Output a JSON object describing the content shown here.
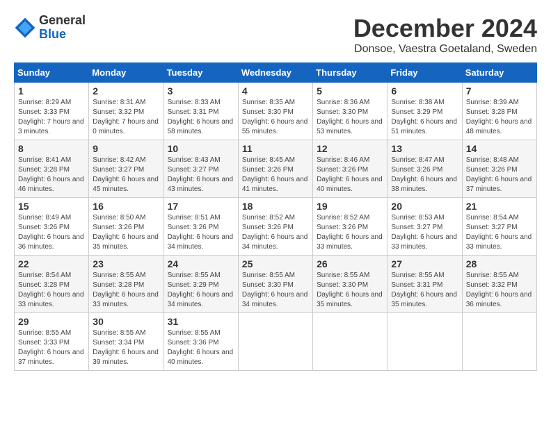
{
  "logo": {
    "general": "General",
    "blue": "Blue"
  },
  "title": "December 2024",
  "location": "Donsoe, Vaestra Goetaland, Sweden",
  "days_of_week": [
    "Sunday",
    "Monday",
    "Tuesday",
    "Wednesday",
    "Thursday",
    "Friday",
    "Saturday"
  ],
  "weeks": [
    [
      {
        "day": "1",
        "sunrise": "Sunrise: 8:29 AM",
        "sunset": "Sunset: 3:33 PM",
        "daylight": "Daylight: 7 hours and 3 minutes."
      },
      {
        "day": "2",
        "sunrise": "Sunrise: 8:31 AM",
        "sunset": "Sunset: 3:32 PM",
        "daylight": "Daylight: 7 hours and 0 minutes."
      },
      {
        "day": "3",
        "sunrise": "Sunrise: 8:33 AM",
        "sunset": "Sunset: 3:31 PM",
        "daylight": "Daylight: 6 hours and 58 minutes."
      },
      {
        "day": "4",
        "sunrise": "Sunrise: 8:35 AM",
        "sunset": "Sunset: 3:30 PM",
        "daylight": "Daylight: 6 hours and 55 minutes."
      },
      {
        "day": "5",
        "sunrise": "Sunrise: 8:36 AM",
        "sunset": "Sunset: 3:30 PM",
        "daylight": "Daylight: 6 hours and 53 minutes."
      },
      {
        "day": "6",
        "sunrise": "Sunrise: 8:38 AM",
        "sunset": "Sunset: 3:29 PM",
        "daylight": "Daylight: 6 hours and 51 minutes."
      },
      {
        "day": "7",
        "sunrise": "Sunrise: 8:39 AM",
        "sunset": "Sunset: 3:28 PM",
        "daylight": "Daylight: 6 hours and 48 minutes."
      }
    ],
    [
      {
        "day": "8",
        "sunrise": "Sunrise: 8:41 AM",
        "sunset": "Sunset: 3:28 PM",
        "daylight": "Daylight: 6 hours and 46 minutes."
      },
      {
        "day": "9",
        "sunrise": "Sunrise: 8:42 AM",
        "sunset": "Sunset: 3:27 PM",
        "daylight": "Daylight: 6 hours and 45 minutes."
      },
      {
        "day": "10",
        "sunrise": "Sunrise: 8:43 AM",
        "sunset": "Sunset: 3:27 PM",
        "daylight": "Daylight: 6 hours and 43 minutes."
      },
      {
        "day": "11",
        "sunrise": "Sunrise: 8:45 AM",
        "sunset": "Sunset: 3:26 PM",
        "daylight": "Daylight: 6 hours and 41 minutes."
      },
      {
        "day": "12",
        "sunrise": "Sunrise: 8:46 AM",
        "sunset": "Sunset: 3:26 PM",
        "daylight": "Daylight: 6 hours and 40 minutes."
      },
      {
        "day": "13",
        "sunrise": "Sunrise: 8:47 AM",
        "sunset": "Sunset: 3:26 PM",
        "daylight": "Daylight: 6 hours and 38 minutes."
      },
      {
        "day": "14",
        "sunrise": "Sunrise: 8:48 AM",
        "sunset": "Sunset: 3:26 PM",
        "daylight": "Daylight: 6 hours and 37 minutes."
      }
    ],
    [
      {
        "day": "15",
        "sunrise": "Sunrise: 8:49 AM",
        "sunset": "Sunset: 3:26 PM",
        "daylight": "Daylight: 6 hours and 36 minutes."
      },
      {
        "day": "16",
        "sunrise": "Sunrise: 8:50 AM",
        "sunset": "Sunset: 3:26 PM",
        "daylight": "Daylight: 6 hours and 35 minutes."
      },
      {
        "day": "17",
        "sunrise": "Sunrise: 8:51 AM",
        "sunset": "Sunset: 3:26 PM",
        "daylight": "Daylight: 6 hours and 34 minutes."
      },
      {
        "day": "18",
        "sunrise": "Sunrise: 8:52 AM",
        "sunset": "Sunset: 3:26 PM",
        "daylight": "Daylight: 6 hours and 34 minutes."
      },
      {
        "day": "19",
        "sunrise": "Sunrise: 8:52 AM",
        "sunset": "Sunset: 3:26 PM",
        "daylight": "Daylight: 6 hours and 33 minutes."
      },
      {
        "day": "20",
        "sunrise": "Sunrise: 8:53 AM",
        "sunset": "Sunset: 3:27 PM",
        "daylight": "Daylight: 6 hours and 33 minutes."
      },
      {
        "day": "21",
        "sunrise": "Sunrise: 8:54 AM",
        "sunset": "Sunset: 3:27 PM",
        "daylight": "Daylight: 6 hours and 33 minutes."
      }
    ],
    [
      {
        "day": "22",
        "sunrise": "Sunrise: 8:54 AM",
        "sunset": "Sunset: 3:28 PM",
        "daylight": "Daylight: 6 hours and 33 minutes."
      },
      {
        "day": "23",
        "sunrise": "Sunrise: 8:55 AM",
        "sunset": "Sunset: 3:28 PM",
        "daylight": "Daylight: 6 hours and 33 minutes."
      },
      {
        "day": "24",
        "sunrise": "Sunrise: 8:55 AM",
        "sunset": "Sunset: 3:29 PM",
        "daylight": "Daylight: 6 hours and 34 minutes."
      },
      {
        "day": "25",
        "sunrise": "Sunrise: 8:55 AM",
        "sunset": "Sunset: 3:30 PM",
        "daylight": "Daylight: 6 hours and 34 minutes."
      },
      {
        "day": "26",
        "sunrise": "Sunrise: 8:55 AM",
        "sunset": "Sunset: 3:30 PM",
        "daylight": "Daylight: 6 hours and 35 minutes."
      },
      {
        "day": "27",
        "sunrise": "Sunrise: 8:55 AM",
        "sunset": "Sunset: 3:31 PM",
        "daylight": "Daylight: 6 hours and 35 minutes."
      },
      {
        "day": "28",
        "sunrise": "Sunrise: 8:55 AM",
        "sunset": "Sunset: 3:32 PM",
        "daylight": "Daylight: 6 hours and 36 minutes."
      }
    ],
    [
      {
        "day": "29",
        "sunrise": "Sunrise: 8:55 AM",
        "sunset": "Sunset: 3:33 PM",
        "daylight": "Daylight: 6 hours and 37 minutes."
      },
      {
        "day": "30",
        "sunrise": "Sunrise: 8:55 AM",
        "sunset": "Sunset: 3:34 PM",
        "daylight": "Daylight: 6 hours and 39 minutes."
      },
      {
        "day": "31",
        "sunrise": "Sunrise: 8:55 AM",
        "sunset": "Sunset: 3:36 PM",
        "daylight": "Daylight: 6 hours and 40 minutes."
      },
      null,
      null,
      null,
      null
    ]
  ]
}
